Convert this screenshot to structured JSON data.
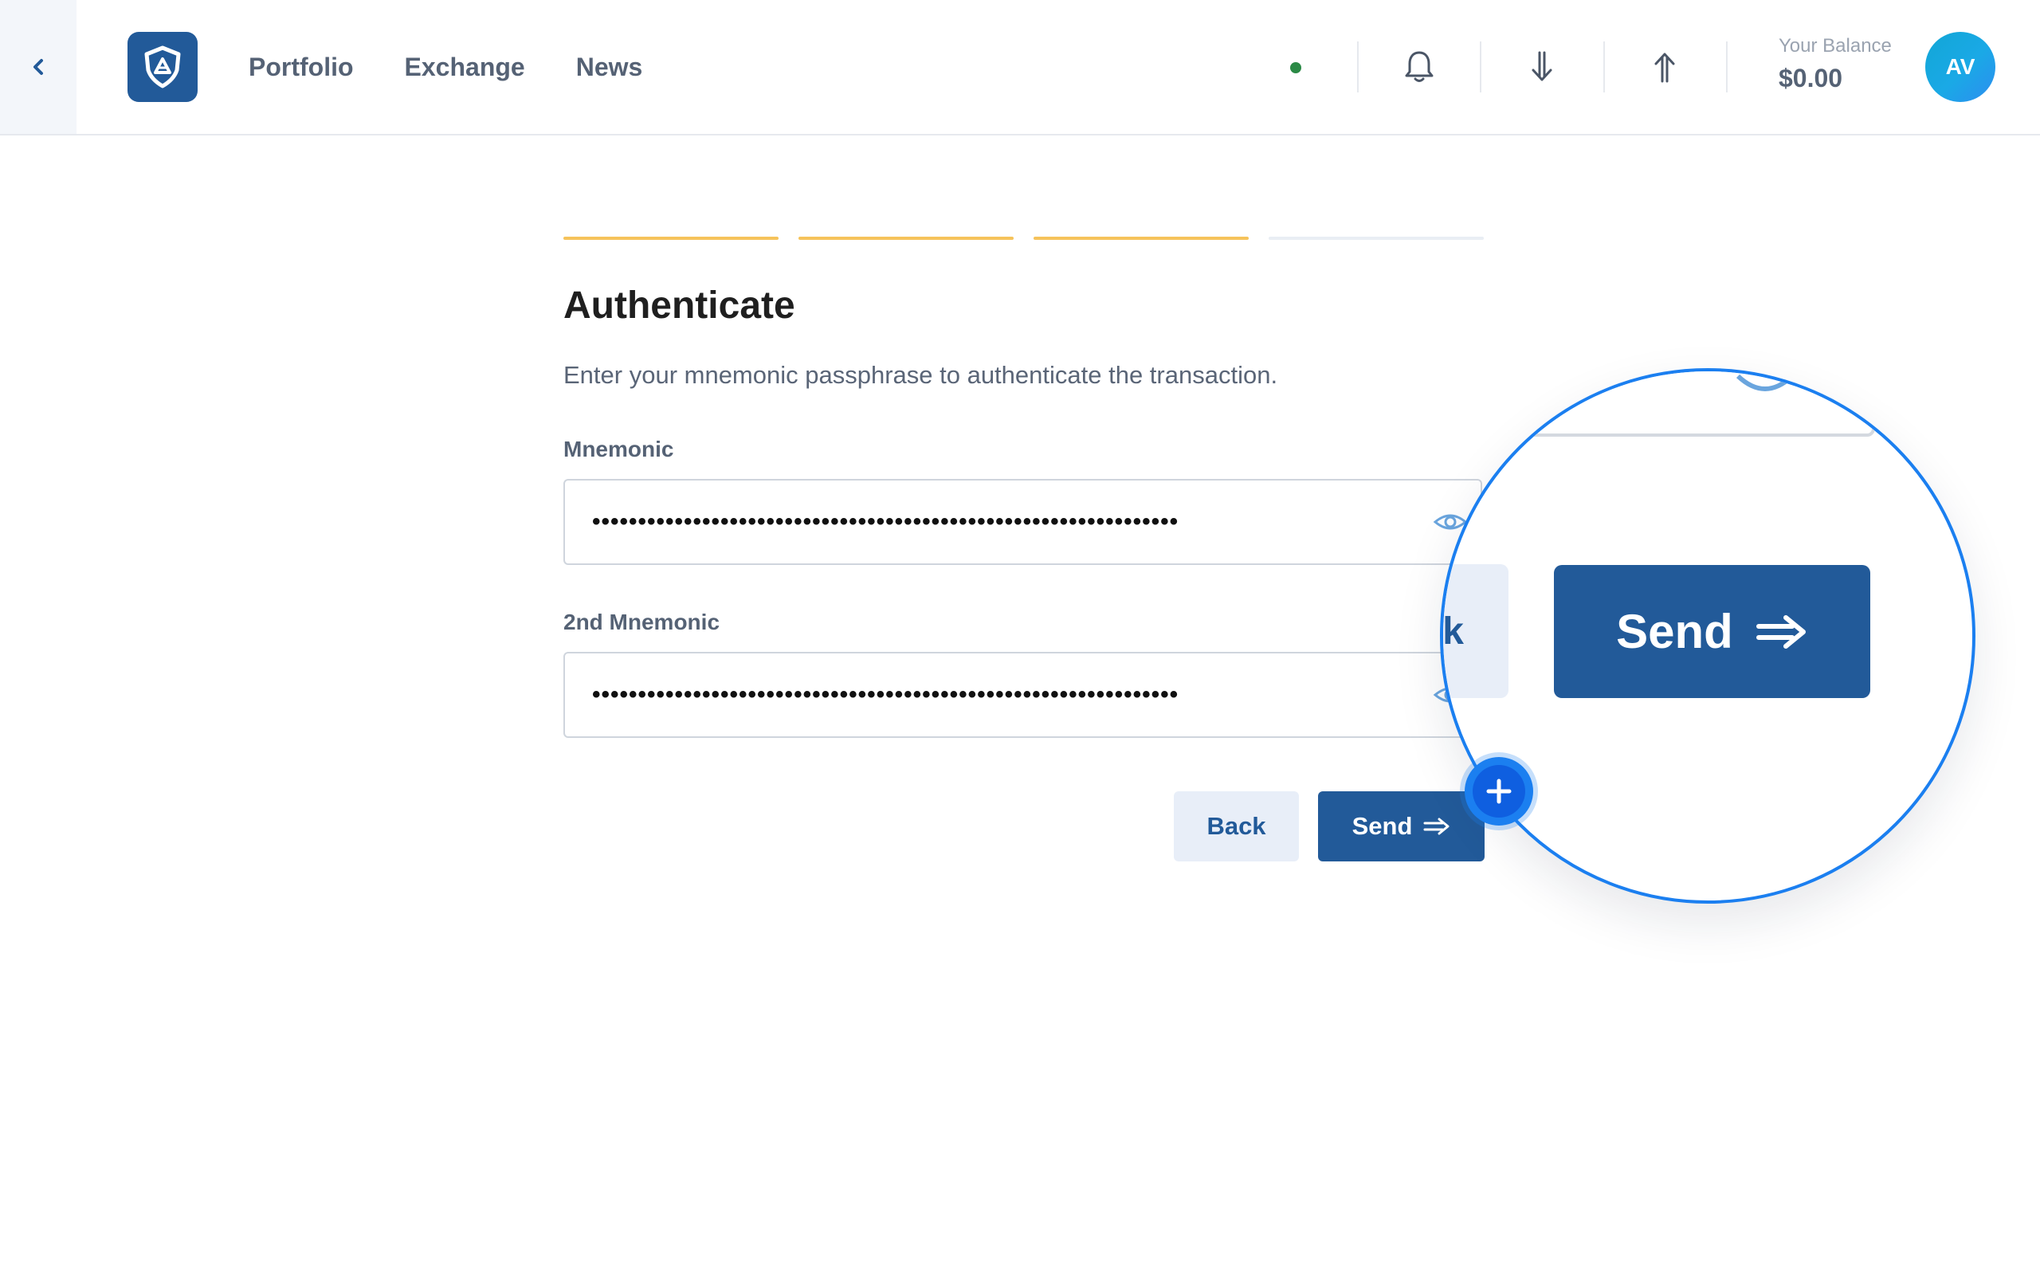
{
  "header": {
    "nav": [
      {
        "label": "Portfolio"
      },
      {
        "label": "Exchange"
      },
      {
        "label": "News"
      }
    ],
    "balance_label": "Your Balance",
    "balance_value": "$0.00",
    "avatar_initials": "AV",
    "status_color": "#2b8a46"
  },
  "steps": {
    "total": 4,
    "completed": 3,
    "active_color": "#f6c35b",
    "inactive_color": "#e9eef4"
  },
  "form": {
    "title": "Authenticate",
    "subtitle": "Enter your mnemonic passphrase to authenticate the transaction.",
    "mnemonic_label": "Mnemonic",
    "mnemonic_value": "••••••••••••••••••••••••••••••••••••••••••••••••••••••••••••••••",
    "second_mnemonic_label": "2nd Mnemonic",
    "second_mnemonic_value": "••••••••••••••••••••••••••••••••••••••••••••••••••••••••••••••••",
    "back_label": "Back",
    "send_label": "Send"
  },
  "magnifier": {
    "dots": "••••",
    "back_fragment": "k",
    "send_label": "Send"
  },
  "colors": {
    "brand": "#225a99",
    "accent": "#1b7ff0"
  }
}
